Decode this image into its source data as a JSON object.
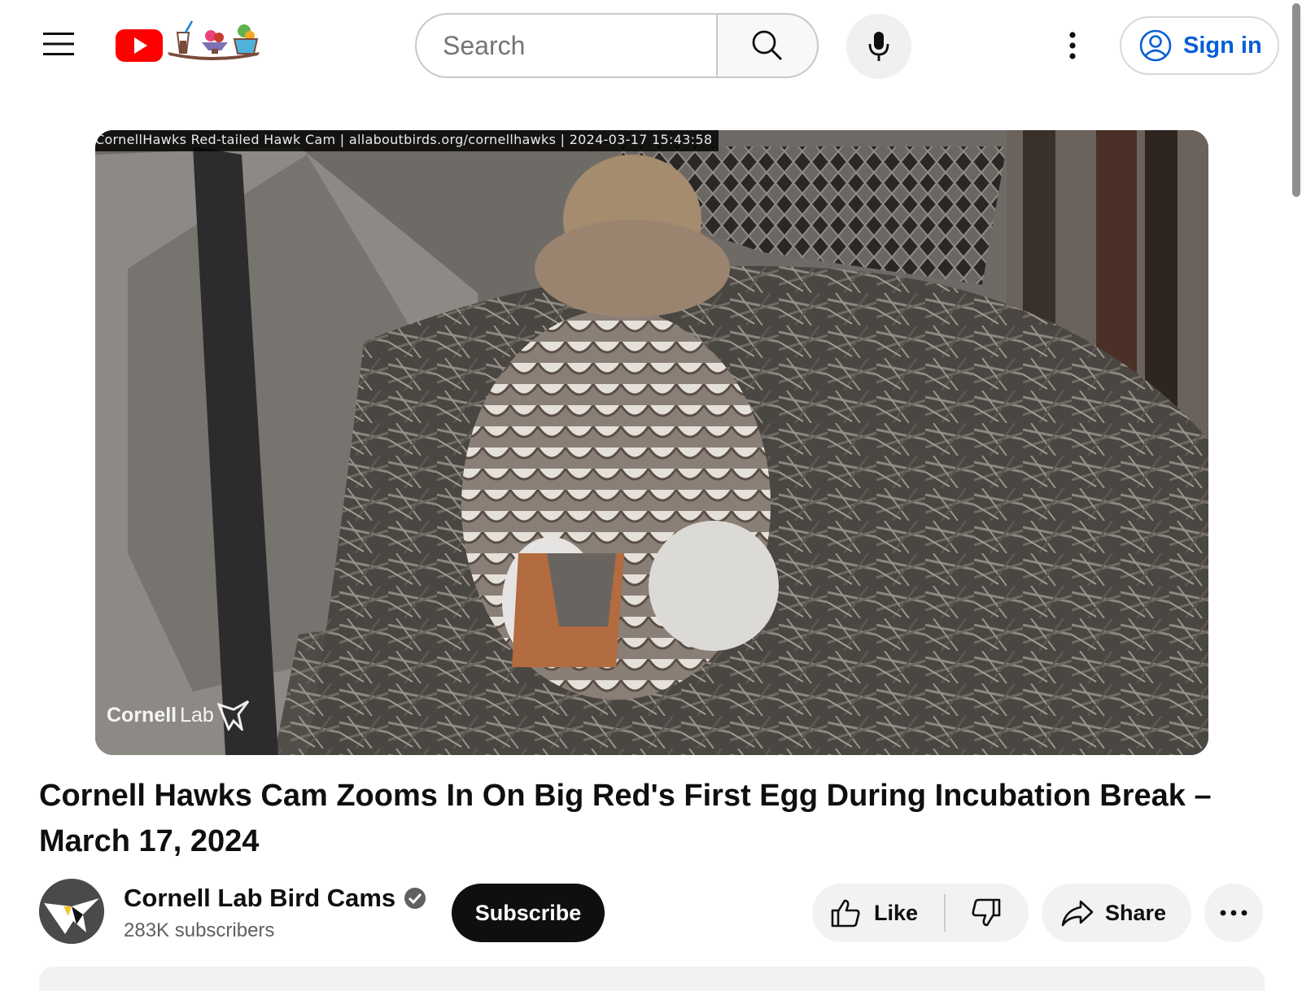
{
  "header": {
    "search_placeholder": "Search",
    "sign_in_label": "Sign in",
    "icons": {
      "menu": "hamburger-menu-icon",
      "logo": "youtube-logo",
      "search": "search-icon",
      "mic": "microphone-icon",
      "more": "vertical-dots-icon",
      "account": "account-circle-icon"
    }
  },
  "player": {
    "overlay_caption": "CornellHawks Red-tailed Hawk Cam | allaboutbirds.org/cornellhawks | 2024-03-17 15:43:58",
    "watermark_bold": "Cornell",
    "watermark_light": "Lab"
  },
  "video": {
    "title": "Cornell Hawks Cam Zooms In On Big Red's First Egg During Incubation Break – March 17, 2024"
  },
  "owner": {
    "channel_name": "Cornell Lab Bird Cams",
    "verified": true,
    "subscribers": "283K subscribers",
    "subscribe_label": "Subscribe"
  },
  "actions": {
    "like_label": "Like",
    "share_label": "Share"
  },
  "colors": {
    "accent_blue": "#065fd4",
    "youtube_red": "#ff0000",
    "subscribe_bg": "#0f0f0f",
    "chip_bg": "#f2f2f2"
  }
}
